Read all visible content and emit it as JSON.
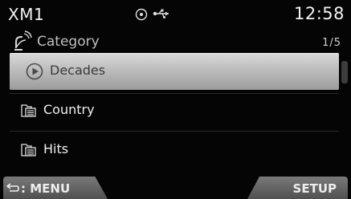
{
  "status": {
    "source": "XM1",
    "time": "12:58",
    "icons": [
      "disc-icon",
      "usb-icon"
    ]
  },
  "header": {
    "title": "Category",
    "icon": "satellite-icon",
    "page": "1/5"
  },
  "list": {
    "items": [
      {
        "label": "Decades",
        "icon": "play-circle-icon",
        "selected": true
      },
      {
        "label": "Country",
        "icon": "folder-list-icon",
        "selected": false
      },
      {
        "label": "Hits",
        "icon": "folder-list-icon",
        "selected": false
      }
    ]
  },
  "bottom": {
    "menu_label": ": MENU",
    "setup_label": "SETUP"
  },
  "colors": {
    "background": "#050505",
    "selected_row": "#bdbdbd",
    "text": "#f0f0f0",
    "button": "#606060"
  }
}
